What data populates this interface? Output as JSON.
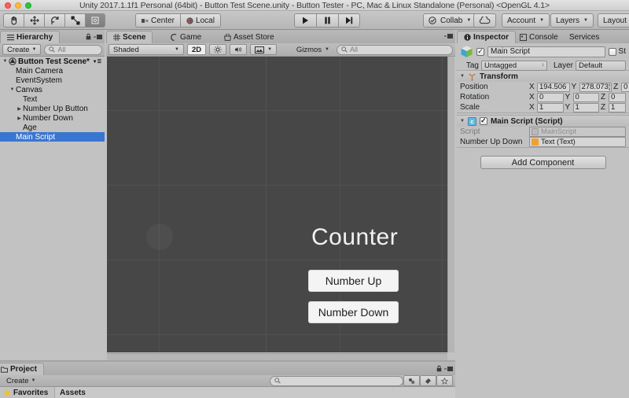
{
  "window": {
    "title": "Unity 2017.1.1f1 Personal (64bit) - Button Test Scene.unity - Button Tester - PC, Mac & Linux Standalone (Personal) <OpenGL 4.1>"
  },
  "toolbar": {
    "tools": [
      {
        "name": "hand-tool",
        "icon": "hand"
      },
      {
        "name": "move-tool",
        "icon": "move"
      },
      {
        "name": "rotate-tool",
        "icon": "rotate"
      },
      {
        "name": "scale-tool",
        "icon": "scale"
      },
      {
        "name": "rect-tool",
        "icon": "rect",
        "selected": true
      }
    ],
    "pivot_label": "Center",
    "space_label": "Local",
    "play_label": "▶",
    "pause_label": "Ⅱ",
    "step_label": "▶|",
    "collab_label": "Collab",
    "account_label": "Account",
    "layers_label": "Layers",
    "layout_label": "Layout"
  },
  "hierarchy": {
    "tab_label": "Hierarchy",
    "create_label": "Create",
    "search_placeholder": "All",
    "scene_name": "Button Test Scene*",
    "items": [
      {
        "label": "Main Camera",
        "indent": 1,
        "arrow": "",
        "selected": false
      },
      {
        "label": "EventSystem",
        "indent": 1,
        "arrow": "",
        "selected": false
      },
      {
        "label": "Canvas",
        "indent": 1,
        "arrow": "▼",
        "selected": false
      },
      {
        "label": "Text",
        "indent": 2,
        "arrow": "",
        "selected": false
      },
      {
        "label": "Number Up Button",
        "indent": 2,
        "arrow": "▶",
        "selected": false
      },
      {
        "label": "Number Down",
        "indent": 2,
        "arrow": "▶",
        "selected": false
      },
      {
        "label": "Age",
        "indent": 2,
        "arrow": "",
        "selected": false
      },
      {
        "label": "Main Script",
        "indent": 1,
        "arrow": "",
        "selected": true
      }
    ]
  },
  "scene": {
    "tabs": [
      {
        "label": "Scene",
        "active": true,
        "icon": "grid-icon"
      },
      {
        "label": "Game",
        "active": false,
        "icon": "game-icon"
      },
      {
        "label": "Asset Store",
        "active": false,
        "icon": "store-icon"
      }
    ],
    "shading_label": "Shaded",
    "mode_2d_label": "2D",
    "gizmos_label": "Gizmos",
    "search_placeholder": "All",
    "content": {
      "counter_text": "Counter",
      "button_up_label": "Number Up",
      "button_down_label": "Number Down"
    }
  },
  "inspector": {
    "tabs": [
      {
        "label": "Inspector",
        "active": true
      },
      {
        "label": "Console",
        "active": false
      },
      {
        "label": "Services",
        "active": false
      }
    ],
    "object_name": "Main Script",
    "object_enabled": true,
    "static_label": "St",
    "tag_label": "Tag",
    "tag_value": "Untagged",
    "layer_label": "Layer",
    "layer_value": "Default",
    "transform": {
      "title": "Transform",
      "rows": [
        {
          "label": "Position",
          "x": "194.506",
          "y": "278.073¦",
          "z": "0"
        },
        {
          "label": "Rotation",
          "x": "0",
          "y": "0",
          "z": "0"
        },
        {
          "label": "Scale",
          "x": "1",
          "y": "1",
          "z": "1"
        }
      ]
    },
    "script_component": {
      "title": "Main Script (Script)",
      "enabled": true,
      "script_label": "Script",
      "script_value": "MainScript",
      "field_label": "Number Up Down",
      "field_value": "Text (Text)"
    },
    "add_component_label": "Add Component"
  },
  "project": {
    "tab_label": "Project",
    "create_label": "Create",
    "favorites_label": "Favorites",
    "assets_label": "Assets"
  },
  "colors": {
    "chrome": "#c2c2c2",
    "selection_blue": "#3a76d1",
    "scene_bg": "#474747",
    "ui_button_bg": "#f4f4f4"
  }
}
